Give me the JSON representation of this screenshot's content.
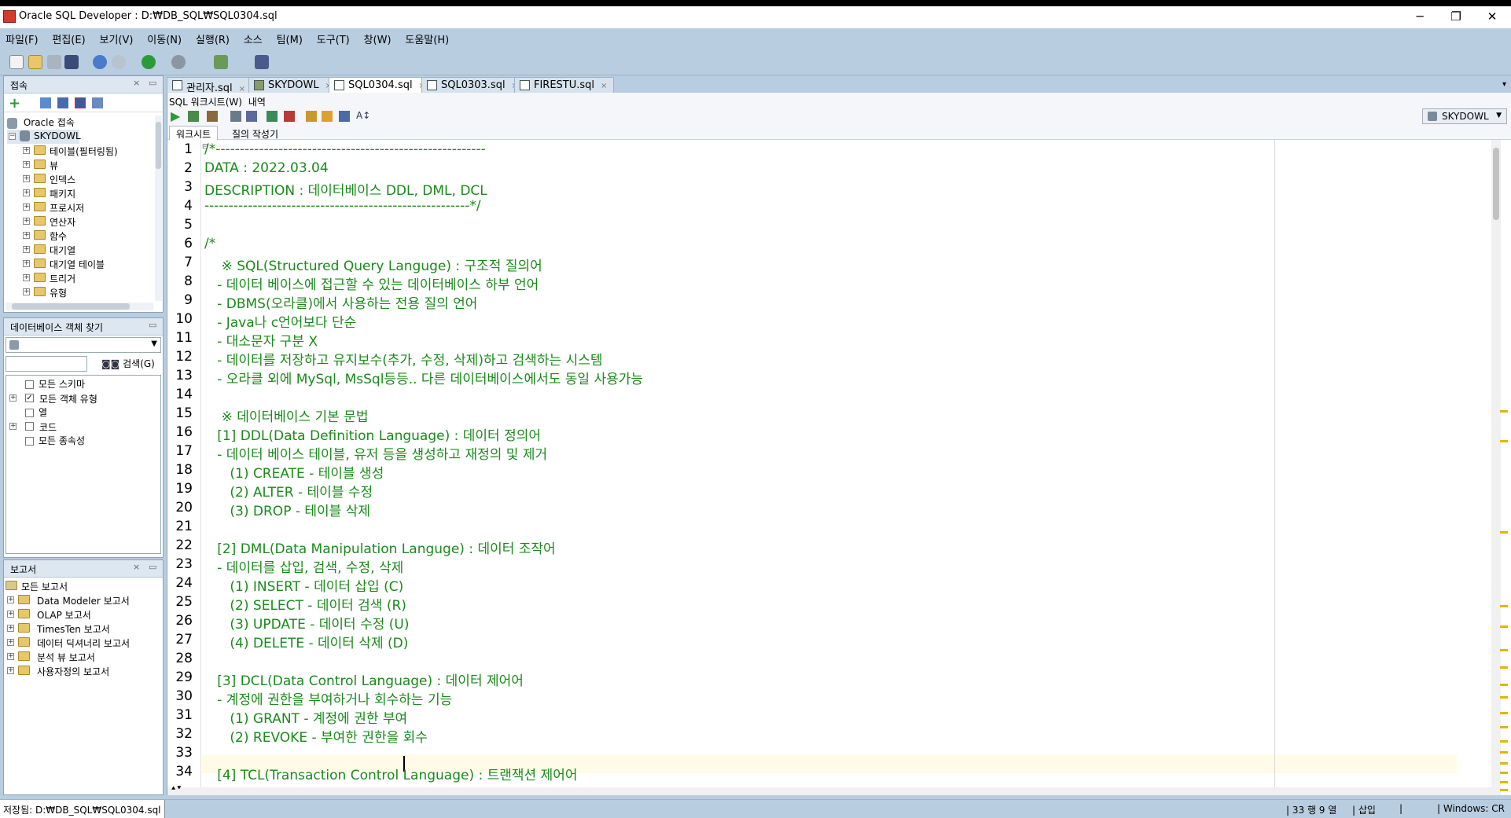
{
  "window": {
    "title": "Oracle SQL Developer : D:₩DB_SQL₩SQL0304.sql",
    "controls": [
      "─",
      "❐",
      "✕"
    ]
  },
  "menu": [
    "파일(F)",
    "편집(E)",
    "보기(V)",
    "이동(N)",
    "실행(R)",
    "소스",
    "팀(M)",
    "도구(T)",
    "창(W)",
    "도움말(H)"
  ],
  "connections_panel": {
    "title": "접속",
    "root": "Oracle 접속",
    "connection": "SKYDOWL",
    "items": [
      "테이블(필터링됨)",
      "뷰",
      "인덱스",
      "패키지",
      "프로시저",
      "연산자",
      "함수",
      "대기열",
      "대기열 테이블",
      "트리거",
      "유형"
    ]
  },
  "db_finder": {
    "title": "데이터베이스 객체 찾기",
    "search_button": "검색(G)",
    "options": [
      {
        "label": "모든 스키마",
        "checked": false
      },
      {
        "label": "모든 객체 유형",
        "checked": true
      },
      {
        "label": "열",
        "checked": false
      },
      {
        "label": "코드",
        "checked": false
      },
      {
        "label": "모든 종속성",
        "checked": false
      }
    ]
  },
  "reports_panel": {
    "title": "보고서",
    "root": "모든 보고서",
    "items": [
      "Data Modeler 보고서",
      "OLAP 보고서",
      "TimesTen 보고서",
      "데이터 딕셔너리 보고서",
      "분석 뷰 보고서",
      "사용자정의 보고서"
    ]
  },
  "editor_tabs": [
    {
      "label": "관리자.sql",
      "active": false
    },
    {
      "label": "SKYDOWL",
      "active": false
    },
    {
      "label": "SQL0304.sql",
      "active": true
    },
    {
      "label": "SQL0303.sql",
      "active": false
    },
    {
      "label": "FIRESTU.sql",
      "active": false
    }
  ],
  "worksheet": {
    "subtabs": [
      "SQL 워크시트(W)",
      "내역"
    ],
    "connection_selector": "SKYDOWL",
    "view_tabs": [
      "워크시트",
      "질의 작성기"
    ]
  },
  "code_lines": [
    "/*--------------------------------------------------------",
    "DATA : 2022.03.04",
    "DESCRIPTION : 데이터베이스 DDL, DML, DCL",
    "-------------------------------------------------------*/",
    "",
    "/*",
    "    ※ SQL(Structured Query Languge) : 구조적 질의어",
    "   - 데이터 베이스에 접근할 수 있는 데이터베이스 하부 언어",
    "   - DBMS(오라클)에서 사용하는 전용 질의 언어",
    "   - Java나 c언어보다 단순",
    "   - 대소문자 구분 X",
    "   - 데이터를 저장하고 유지보수(추가, 수정, 삭제)하고 검색하는 시스템",
    "   - 오라클 외에 MySql, MsSql등등.. 다른 데이터베이스에서도 동일 사용가능",
    "",
    "    ※ 데이터베이스 기본 문법",
    "   [1] DDL(Data Definition Language) : 데이터 정의어",
    "   - 데이터 베이스 테이블, 유저 등을 생성하고 재정의 및 제거",
    "      (1) CREATE - 테이블 생성",
    "      (2) ALTER - 테이블 수정",
    "      (3) DROP - 테이블 삭제",
    "",
    "   [2] DML(Data Manipulation Languge) : 데이터 조작어",
    "   - 데이터를 삽입, 검색, 수정, 삭제",
    "      (1) INSERT - 데이터 삽입 (C)",
    "      (2) SELECT - 데이터 검색 (R)",
    "      (3) UPDATE - 데이터 수정 (U)",
    "      (4) DELETE - 데이터 삭제 (D)",
    "",
    "   [3] DCL(Data Control Language) : 데이터 제어어",
    "   - 계정에 권한을 부여하거나 회수하는 기능",
    "      (1) GRANT - 계정에 권한 부여",
    "      (2) REVOKE - 부여한 권한을 회수",
    "",
    "   [4] TCL(Transaction Control Language) : 트랜잭션 제어어"
  ],
  "status": {
    "saved": "저장됨: D:₩DB_SQL₩SQL0304.sql",
    "position": "33 행 9 열",
    "mode": "삽입",
    "eol": "Windows: CR"
  },
  "colors": {
    "chrome": "#b9cde0",
    "code_green": "#1a8a1a",
    "current_line": "#fffbe6",
    "marker": "#e4b400"
  }
}
